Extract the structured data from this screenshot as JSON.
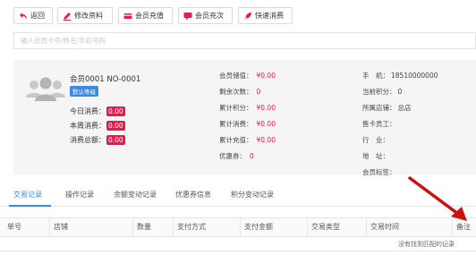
{
  "toolbar": {
    "back_label": "返回",
    "edit_label": "修改资料",
    "recharge_label": "会员充值",
    "recharge_times_label": "会员充次",
    "quick_consume_label": "快速消费"
  },
  "search": {
    "placeholder": "输入会员卡号/姓名/手机号码"
  },
  "member": {
    "name": "会员0001  NO-0001",
    "level": "默认等级",
    "today_label": "今日消费：",
    "today_value": "0.00",
    "week_label": "本周消费：",
    "week_value": "0.00",
    "total_label": "消费总额：",
    "total_value": "0.00"
  },
  "balances": {
    "stored_label": "会员储值：",
    "stored_value": "¥0.00",
    "times_label": "剩余次数：",
    "times_value": "0",
    "points_label": "累计积分：",
    "points_value": "¥0.00",
    "consume_label": "累计消费：",
    "consume_value": "¥0.00",
    "recharge_label": "累计充值：",
    "recharge_value": "¥0.00",
    "coupon_label": "优惠券：",
    "coupon_value": "0"
  },
  "info": {
    "phone_label": "手　机：",
    "phone_value": "18510000000",
    "current_points_label": "当前积分：",
    "current_points_value": "0",
    "store_label": "所属店铺：",
    "store_value": "总店",
    "seller_label": "售卡员工：",
    "seller_value": "",
    "industry_label": "行　业：",
    "industry_value": "",
    "address_label": "地　址：",
    "address_value": "",
    "tags_label": "会员标签：",
    "tags_value": ""
  },
  "tabs": [
    "交易记录",
    "操作记录",
    "余额变动记录",
    "优惠券信息",
    "积分变动记录"
  ],
  "table": {
    "headers": [
      "单号",
      "店铺",
      "数量",
      "支付方式",
      "支付金额",
      "交易类型",
      "交易时间",
      "备注"
    ],
    "empty_text": "没有找到匹配的记录"
  },
  "colors": {
    "accent_blue": "#3b89e0",
    "accent_red": "#e8194e",
    "annotation_arrow": "#cc1111"
  }
}
